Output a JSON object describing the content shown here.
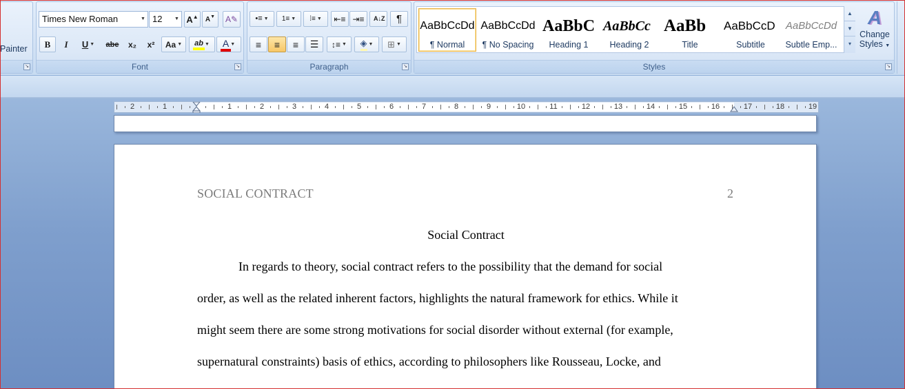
{
  "clipboard": {
    "painter_label": "Painter"
  },
  "font": {
    "group_label": "Font",
    "font_name": "Times New Roman",
    "font_size": "12",
    "grow_label": "A",
    "shrink_label": "A",
    "bold_label": "B",
    "italic_label": "I",
    "underline_label": "U",
    "strike_label": "abe",
    "subscript_label": "x₂",
    "superscript_label": "x²",
    "case_label": "Aa",
    "highlight_label": "ab",
    "color_label": "A",
    "highlight_color": "#ffff00",
    "font_color": "#e00000"
  },
  "paragraph": {
    "group_label": "Paragraph",
    "pilcrow": "¶",
    "sort_label": "A↓Z"
  },
  "styles": {
    "group_label": "Styles",
    "items": [
      {
        "sample": "AaBbCcDd",
        "name": "¶ Normal"
      },
      {
        "sample": "AaBbCcDd",
        "name": "¶ No Spacing"
      },
      {
        "sample": "AaBbC",
        "name": "Heading 1"
      },
      {
        "sample": "AaBbCc",
        "name": "Heading 2"
      },
      {
        "sample": "AaBb",
        "name": "Title"
      },
      {
        "sample": "AaBbCcD",
        "name": "Subtitle"
      },
      {
        "sample": "AaBbCcDd",
        "name": "Subtle Emp..."
      }
    ],
    "change_styles_line1": "Change",
    "change_styles_line2": "Styles",
    "change_styles_icon": "A"
  },
  "ruler": {
    "labels": [
      "2",
      "1",
      "1",
      "2",
      "3",
      "4",
      "5",
      "6",
      "7",
      "8",
      "9",
      "10",
      "11",
      "12",
      "13",
      "14",
      "15",
      "16",
      "17",
      "18",
      "19"
    ]
  },
  "document": {
    "header_left": "SOCIAL CONTRACT",
    "header_right": "2",
    "title": "Social Contract",
    "lines": [
      "In regards to theory, social contract refers to the possibility that the demand  for social",
      "order, as well as the related inherent factors, highlights the natural framework for ethics. While it",
      "might seem there are some strong motivations for social disorder without external (for example,",
      "supernatural constraints) basis of ethics, according to philosophers like Rousseau, Locke, and"
    ]
  }
}
